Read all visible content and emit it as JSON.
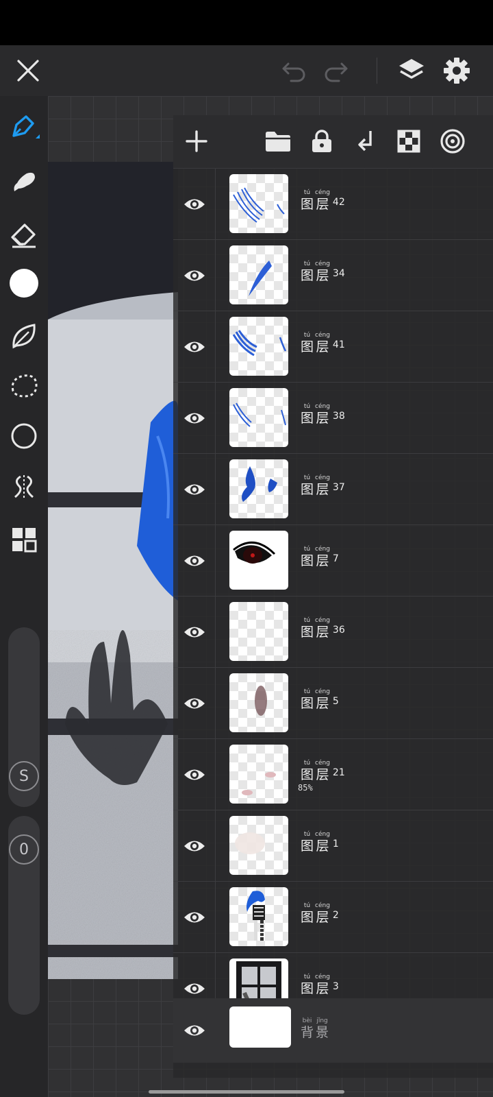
{
  "app": {
    "top_bar": {
      "close_icon": "close-icon",
      "undo_icon": "undo-icon",
      "redo_icon": "redo-icon",
      "layers_icon": "layers-icon",
      "settings_icon": "gear-icon"
    },
    "toolbar": {
      "tools": [
        "pen-tool-icon",
        "smudge-tool-icon",
        "eraser-tool-icon",
        "color-swatch-icon",
        "lasso-leaf-icon",
        "selection-lasso-icon",
        "shape-circle-icon",
        "symmetry-icon",
        "grid-apps-icon"
      ],
      "active_color": "#ffffff",
      "accent": "#1e9bf0",
      "size_slider_label": "S",
      "opacity_slider_label": "0"
    },
    "layer_panel": {
      "toolbar_icons": [
        "add-layer-icon",
        "folder-icon",
        "lock-icon",
        "merge-down-icon",
        "transparency-checker-icon",
        "blend-target-icon"
      ],
      "layer_word": {
        "chars": [
          "图",
          "层"
        ],
        "pinyin": [
          "tú",
          "céng"
        ]
      },
      "layers": [
        {
          "number": "42",
          "opacity": ""
        },
        {
          "number": "34",
          "opacity": ""
        },
        {
          "number": "41",
          "opacity": ""
        },
        {
          "number": "38",
          "opacity": ""
        },
        {
          "number": "37",
          "opacity": ""
        },
        {
          "number": "7",
          "opacity": ""
        },
        {
          "number": "36",
          "opacity": ""
        },
        {
          "number": "5",
          "opacity": ""
        },
        {
          "number": "21",
          "opacity": "85%"
        },
        {
          "number": "1",
          "opacity": ""
        },
        {
          "number": "2",
          "opacity": ""
        },
        {
          "number": "3",
          "opacity": ""
        }
      ],
      "background": {
        "chars": [
          "背",
          "景"
        ],
        "pinyin": [
          "bèi",
          "jǐng"
        ]
      }
    }
  }
}
